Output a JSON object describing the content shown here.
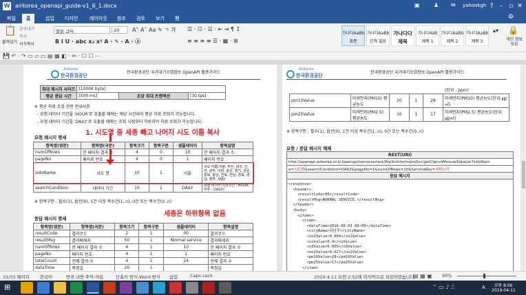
{
  "window": {
    "title": "airkorea_openapi_guide-v1_6_1.docx",
    "user": "yahookgh",
    "help": "?"
  },
  "tabs": [
    "파일",
    "홈",
    "삽입",
    "디자인",
    "레이아웃",
    "참조",
    "검토",
    "보기",
    "팸"
  ],
  "ribbon": {
    "paste": "붙여넣기",
    "cut": "잘라내기",
    "copy": "복사",
    "format_painter": "서식복사",
    "font_name": "맑은 고딕",
    "font_size": "10",
    "styles": [
      {
        "preview": "가나다AaBb",
        "name": "표준"
      },
      {
        "preview": "가나다AaBb",
        "name": "간격 없음"
      },
      {
        "preview": "가나다다",
        "name": "제목"
      },
      {
        "preview": "가나다AaB",
        "name": "제목 1"
      },
      {
        "preview": "가나다AaBb",
        "name": "제목 2"
      },
      {
        "preview": "가나다AaBbC",
        "name": "제목 3"
      }
    ],
    "privacy": "개인 정보 보호"
  },
  "left_page": {
    "header_text": "한국환경공단 국가대기오염정보 OpenAPI 활용가이드",
    "logo_text": "한국환경공단",
    "logo_small": "AirKorea",
    "info_rows": [
      [
        "최대 메시지 사이즈",
        "[1000K byte]"
      ],
      [
        "평균 응답 시간",
        "[500 ms]",
        "초당 최대 트랜잭션",
        "[30 tps]"
      ]
    ],
    "note1": "※ 평균 자료 조회 관련 안내사항",
    "note2": "- 요청 데이터 기간을 'HOUR'로 호출할 때에는 해당 시간대의 평균 자료 조회가 가능합니다.",
    "note3": "- 요청 데이터 기간을 'DAILY'로 호출할 때에는 조회 시점부터 하루치의 자료 조회가 가능합니다.",
    "annot1": "1. 시도명 중 세종 빼고 나머지 시도 이름 복사",
    "req_title": "요청 메시지 명세",
    "req_headers": [
      "항목명(영문)",
      "항목명(국문)",
      "항목크기",
      "항목구분",
      "샘플데이터",
      "항목설명"
    ],
    "req_rows": [
      [
        "numOfRows",
        "한 페이지 결과 수",
        "4",
        "0",
        "10",
        "한 페이지 결과 수"
      ],
      [
        "pageNo",
        "페이지 번호",
        "4",
        "0",
        "1",
        "페이지 번호"
      ],
      [
        "sidoName",
        "시도 명",
        "10",
        "1",
        "서울",
        "시도 이름(서울, 부산, 대구, 인천, 광주, 대전, 울산, 경기, 강원, 충북, 충남, 전북, 전남, 경북, 경남, 제주, 세종)"
      ],
      [
        "searchCondition",
        "데이터 기간",
        "10",
        "1",
        "DAILY",
        "요청 데이터기간(시간 : HOUR, 하루 : DAILY)"
      ]
    ],
    "note4": "※ 항목구분 : 필수(1), 옵션(0), 1건 이상 복수건(1..n), 0건 또는 복수건(0..n)",
    "annot2": "세종은 하위항목 없음",
    "resp_title": "응답 메시지 명세",
    "resp_headers": [
      "항목명(영문)",
      "항목명(국문)",
      "항목크기",
      "항목구분",
      "샘플데이터",
      "항목설명"
    ],
    "resp_rows": [
      [
        "resultCode",
        "결과코드",
        "2",
        "1",
        "00",
        "결과코드"
      ],
      [
        "resultMsg",
        "결과메세지",
        "50",
        "1",
        "Normal service",
        "결과메세지"
      ],
      [
        "numOfRows",
        "한 페이지 결과 수",
        "4",
        "1",
        "10",
        "한 페이지 결과 수"
      ],
      [
        "pageNo",
        "페이지 번호",
        "4",
        "1",
        "1",
        "페이지 번호"
      ],
      [
        "totalCount",
        "전체 결과 수",
        "4",
        "1",
        "24",
        "전체 결과 수"
      ],
      [
        "dataTime",
        "측정일",
        "20",
        "1",
        "",
        "측정일"
      ]
    ]
  },
  "right_page": {
    "header_text": "한국환경공단 국가대기오염정보 OpenAPI 활용가이드",
    "unit_top": "(단위 : ppm)",
    "rows": [
      [
        "pm10Value",
        "미세먼지(PM10) 평균농도",
        "10",
        "1",
        "28",
        "미세먼지(PM10) 평균농도(단위:㎍/㎥)"
      ],
      [
        "pm25Value",
        "미세먼지(PM2.5) 평균농도",
        "10",
        "1",
        "17",
        "미세먼지(PM2.5) 평균농도(단위:㎍/㎥)"
      ]
    ],
    "note": "※ 항목구분 : 필수(1), 옵션(0), 1건 이상 복수건(1..n), 0건 또는 복수건(0..n)",
    "example_title": "요청 / 응답 메시지 예제",
    "rest_label": "REST(URI)",
    "rest_url1": "http://openapi.airkorea.or.kr/openapi/services/rest/ArpltnInforInqireSvc/getCtprvnMesureSidoLIst?sidoNam",
    "rest_url2a": "e=",
    "rest_url2b": "시도명",
    "rest_url2c": "&searchCondition=DAILY&pageNo=1&numOfRows=10&ServiceKey=",
    "rest_url2d": "서비스키",
    "resp_label": "응답 메시지",
    "xml": "<response>\n  <header>\n    <resultCode>00</resultCode>\n    <resultMsg>NORMAL SERVICE.</resultMsg>\n  </header>\n  <body>\n    <items>\n      <item>\n        <dataTime>2016-08-03 08:00</dataTime>\n        <cityName>강남구</cityName>\n        <so2Value>0.004</so2Value>\n        <coValue>0.4</coValue>\n        <o3Value>0.005</o3Value>\n        <no2Value>0.027</no2Value>\n        <pm10Value>28</pm10Value>\n        <pm25Value>17</pm25Value>\n      </item>\n      <item>"
  },
  "status": {
    "page": "31/55 페이지",
    "lang": "한국어",
    "track": "변경 내용 추적:꺼짐",
    "compat": "단축키 방식:Word 방식",
    "insert": "삽입",
    "caps": "Caps Lock",
    "save": "2019.4.11 오전 2:52에 마지막으로 저장하였습니다.",
    "zoom": "90%"
  },
  "taskbar": {
    "time": "오후 8:06",
    "date": "2019-04-11",
    "lang": "A"
  }
}
